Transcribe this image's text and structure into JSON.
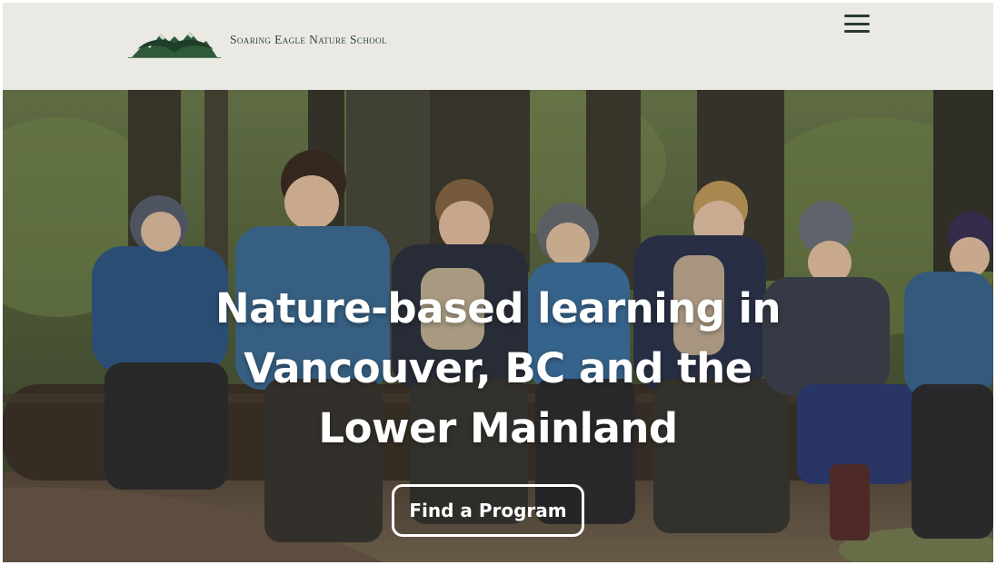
{
  "header": {
    "brand_name": "Soaring Eagle Nature School",
    "logo_icon": "eagle-mountain-logo",
    "menu_icon": "hamburger-menu-icon"
  },
  "hero": {
    "title": "Nature-based learning in Vancouver, BC and the Lower Mainland",
    "cta_label": "Find a Program",
    "photo": "children-sitting-on-log-in-forest"
  },
  "colors": {
    "header_bg": "#ebe9e4",
    "brand_green": "#2d4a35",
    "hero_text": "#ffffff"
  }
}
